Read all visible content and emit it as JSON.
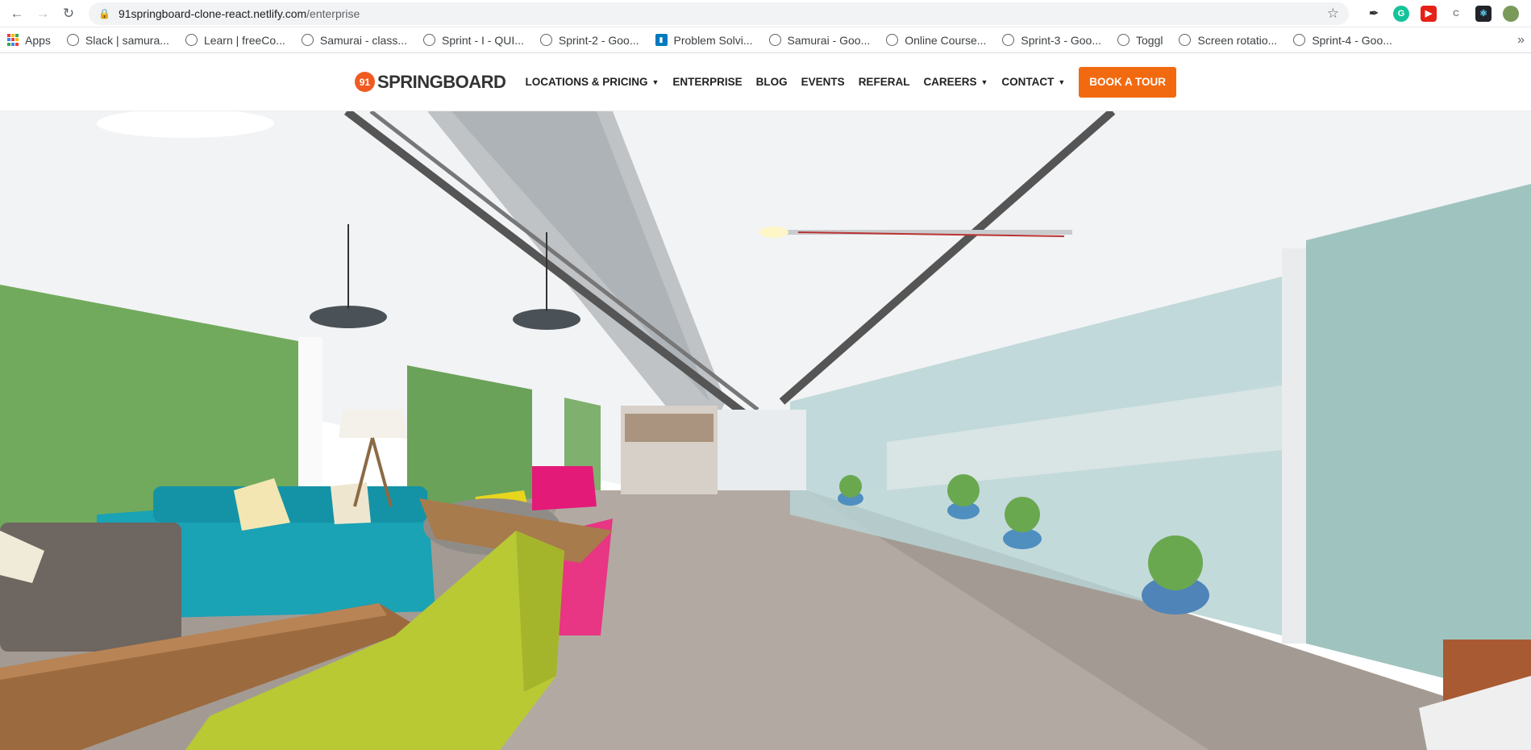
{
  "browser": {
    "url_host": "91springboard-clone-react.netlify.com",
    "url_path": "/enterprise",
    "icons": [
      "back-icon",
      "forward-icon",
      "reload-icon",
      "lock-icon",
      "star-icon"
    ],
    "extensions": [
      "pen-extension-icon",
      "grammarly-icon",
      "youtube-icon",
      "ci-extension-icon",
      "react-devtools-icon",
      "profile-avatar"
    ]
  },
  "bookmarks": {
    "apps_label": "Apps",
    "items": [
      "Slack | samura...",
      "Learn | freeCo...",
      "Samurai - class...",
      "Sprint - I - QUI...",
      "Sprint-2 - Goo...",
      "Problem Solvi...",
      "Samurai - Goo...",
      "Online Course...",
      "Sprint-3 - Goo...",
      "Toggl",
      "Screen rotatio...",
      "Sprint-4 - Goo..."
    ],
    "more": "»"
  },
  "site": {
    "logo_badge": "91",
    "logo_text": "SPRINGBOARD",
    "menu": {
      "locations": "LOCATIONS & PRICING",
      "enterprise": "ENTERPRISE",
      "blog": "BLOG",
      "events": "EVENTS",
      "referal": "REFERAL",
      "careers": "CAREERS",
      "contact": "CONTACT"
    },
    "cta": "BOOK A TOUR",
    "accent": "#f26a10"
  },
  "hero": {
    "image_subject": "coworking-office-interior"
  }
}
